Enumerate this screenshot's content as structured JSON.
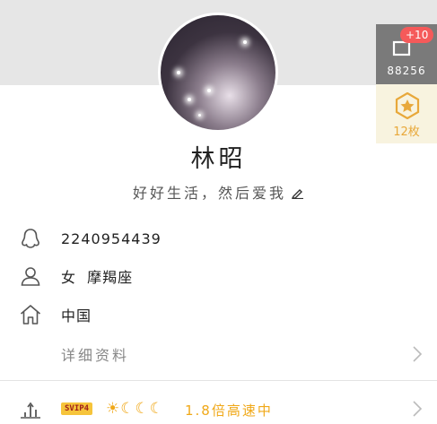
{
  "profile": {
    "nickname": "林昭",
    "signature": "好好生活，然后爱我"
  },
  "info": {
    "qq_number": "2240954439",
    "gender_zodiac": "女  摩羯座",
    "location": "中国",
    "detail_label": "详细资料"
  },
  "vip": {
    "badge": "SVIP4",
    "level_icons": "☀☾☾☾",
    "speed_text": "1.8倍高速中"
  },
  "side": {
    "like_plus": "+10",
    "like_count": "88256",
    "medal_count": "12枚"
  },
  "colors": {
    "accent_orange": "#f0a818",
    "like_badge": "#f55a5a"
  },
  "icons": [
    "qq-penguin-icon",
    "person-icon",
    "home-icon",
    "chevron-right-icon",
    "vip-growth-icon",
    "edit-pen-icon",
    "like-thumb-icon",
    "medal-star-icon"
  ]
}
